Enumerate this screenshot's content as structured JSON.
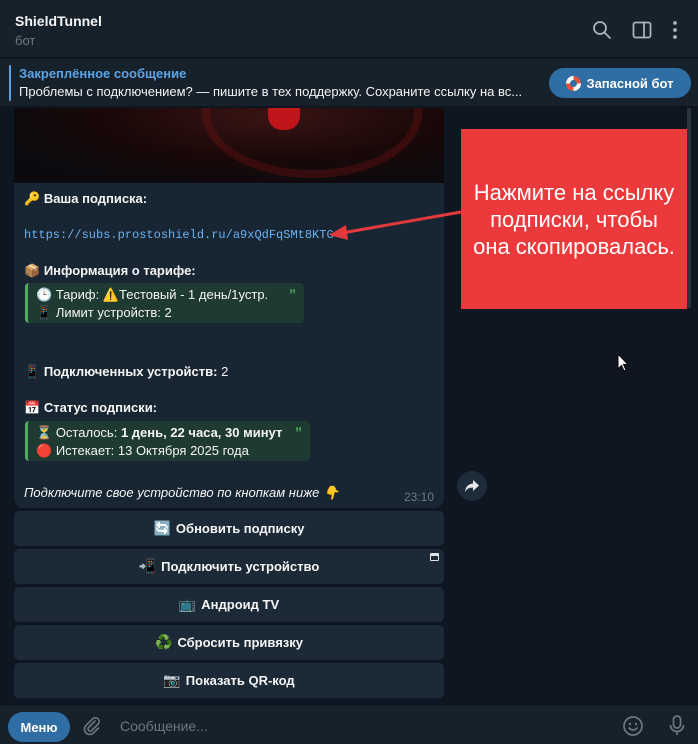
{
  "header": {
    "title": "ShieldTunnel",
    "subtitle": "бот"
  },
  "pinned": {
    "title": "Закреплённое сообщение",
    "text": "Проблемы с подключением? — пишите в тех поддержку. Сохраните ссылку на вс...",
    "button_label": "Запасной бот"
  },
  "message": {
    "subscription_heading": "Ваша подписка:",
    "subscription_link": "https://subs.prostoshield.ru/a9xQdFqSMt8KTG",
    "tariff_heading": "Информация о тарифе:",
    "tariff_label": "Тариф:",
    "tariff_value": "Тестовый - 1 день/1устр.",
    "device_limit": "Лимит устройств: 2",
    "connected_label": "Подключенных устройств:",
    "connected_value": "2",
    "status_heading": "Статус подписки:",
    "remaining_label": "Осталось:",
    "remaining_value": "1 день, 22 часа, 30 минут",
    "expires": "Истекает: 13 Октября 2025 года",
    "footer": "Подключите свое устройство по кнопкам ниже",
    "time": "23:10"
  },
  "annotation": {
    "text": "Нажмите на ссылку подписки, чтобы она скопировалась."
  },
  "buttons": [
    {
      "icon": "🔄",
      "label": "Обновить подписку"
    },
    {
      "icon": "📲",
      "label": "Подключить устройство"
    },
    {
      "icon": "📺",
      "label": "Андроид TV"
    },
    {
      "icon": "♻️",
      "label": "Сбросить привязку"
    },
    {
      "icon": "📷",
      "label": "Показать QR-код"
    }
  ],
  "input": {
    "menu_label": "Меню",
    "placeholder": "Сообщение..."
  },
  "colors": {
    "accent": "#2f6ea5",
    "link": "#6ab3f3",
    "annotation": "#ec3a3c",
    "quote_border": "#4fae5a"
  }
}
